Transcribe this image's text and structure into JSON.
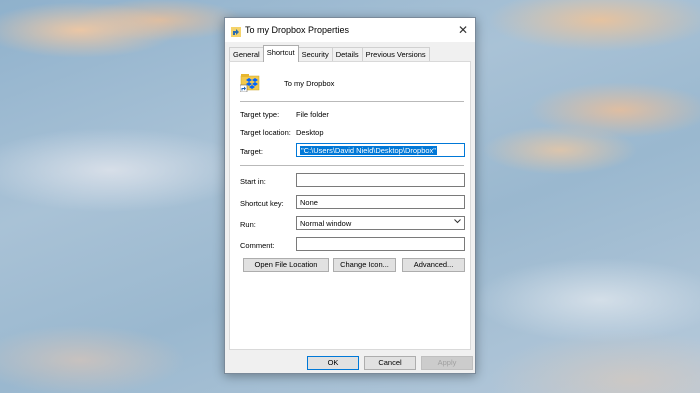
{
  "window": {
    "title": "To my Dropbox Properties",
    "close_label": "✕"
  },
  "tabs": [
    {
      "label": "General"
    },
    {
      "label": "Shortcut"
    },
    {
      "label": "Security"
    },
    {
      "label": "Details"
    },
    {
      "label": "Previous Versions"
    }
  ],
  "shortcut": {
    "name": "To my Dropbox",
    "target_type_label": "Target type:",
    "target_type_value": "File folder",
    "target_location_label": "Target location:",
    "target_location_value": "Desktop",
    "target_label": "Target:",
    "target_value": "\"C:\\Users\\David Nield\\Desktop\\Dropbox\"",
    "start_in_label": "Start in:",
    "start_in_value": "",
    "shortcut_key_label": "Shortcut key:",
    "shortcut_key_value": "None",
    "run_label": "Run:",
    "run_value": "Normal window",
    "comment_label": "Comment:",
    "comment_value": "",
    "open_file_location": "Open File Location",
    "change_icon": "Change Icon...",
    "advanced": "Advanced..."
  },
  "footer": {
    "ok": "OK",
    "cancel": "Cancel",
    "apply": "Apply"
  },
  "icons": {
    "title": "shortcut-icon",
    "shortcut": "dropbox-shortcut-icon",
    "run_dropdown": "chevron-down-icon",
    "close": "close-icon"
  }
}
